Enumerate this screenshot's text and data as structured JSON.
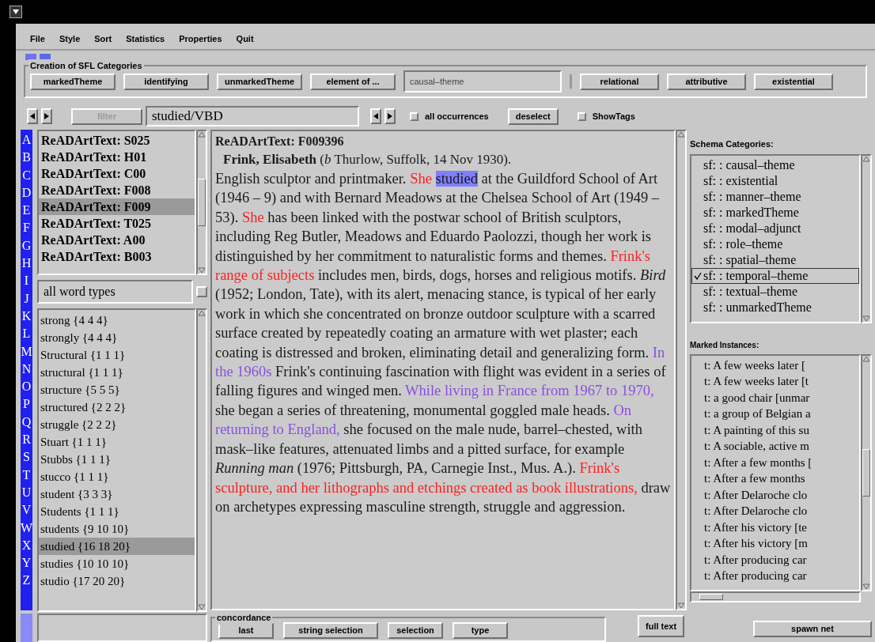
{
  "menu": [
    "File",
    "Style",
    "Sort",
    "Statistics",
    "Properties",
    "Quit"
  ],
  "sfl_group": {
    "title": "Creation of SFL Categories",
    "buttons": [
      "markedTheme",
      "identifying",
      "unmarkedTheme",
      "element of ..."
    ],
    "field_value": "causal–theme",
    "buttons_right": [
      "relational",
      "attributive",
      "existential"
    ]
  },
  "toolbar": {
    "filter": {
      "label": "filter",
      "disabled": true
    },
    "query": "studied/VBD",
    "all_occurrences": {
      "label": "all occurrences",
      "checked": false
    },
    "deselect": "deselect",
    "show_tags": {
      "label": "ShowTags",
      "checked": false
    }
  },
  "alphabet": [
    "A",
    "B",
    "C",
    "D",
    "E",
    "F",
    "G",
    "H",
    "I",
    "J",
    "K",
    "L",
    "M",
    "N",
    "O",
    "P",
    "Q",
    "R",
    "S",
    "T",
    "U",
    "V",
    "W",
    "X",
    "Y",
    "Z"
  ],
  "texts": [
    {
      "label": "ReADArtText: S025",
      "selected": false
    },
    {
      "label": "ReADArtText: H01",
      "selected": false
    },
    {
      "label": "ReADArtText: C00",
      "selected": false
    },
    {
      "label": "ReADArtText: F008",
      "selected": false
    },
    {
      "label": "ReADArtText: F009",
      "selected": true
    },
    {
      "label": "ReADArtText: T025",
      "selected": false
    },
    {
      "label": "ReADArtText: A00",
      "selected": false
    },
    {
      "label": "ReADArtText: B003",
      "selected": false
    }
  ],
  "word_type_filter": "all word types",
  "words": [
    {
      "label": "strong {4 4 4}",
      "selected": false
    },
    {
      "label": "strongly {4 4 4}",
      "selected": false
    },
    {
      "label": "Structural {1 1 1}",
      "selected": false
    },
    {
      "label": "structural {1 1 1}",
      "selected": false
    },
    {
      "label": "structure {5 5 5}",
      "selected": false
    },
    {
      "label": "structured {2 2 2}",
      "selected": false
    },
    {
      "label": "struggle {2 2 2}",
      "selected": false
    },
    {
      "label": "Stuart {1 1 1}",
      "selected": false
    },
    {
      "label": "Stubbs {1 1 1}",
      "selected": false
    },
    {
      "label": "stucco {1 1 1}",
      "selected": false
    },
    {
      "label": "student {3 3 3}",
      "selected": false
    },
    {
      "label": "Students {1 1 1}",
      "selected": false
    },
    {
      "label": "students {9 10 10}",
      "selected": false
    },
    {
      "label": "studied {16 18 20}",
      "selected": true
    },
    {
      "label": "studies {10 10 10}",
      "selected": false
    },
    {
      "label": "studio {17 20 20}",
      "selected": false
    }
  ],
  "document": {
    "title": "ReADArtText: F009396",
    "headword": "Frink, Elisabeth",
    "headword_rest": "(*b* Thurlow, Suffolk, 14 Nov 1930).",
    "segments": [
      {
        "kind": "plain",
        "text": "English sculptor and printmaker. "
      },
      {
        "kind": "marked",
        "text": "She "
      },
      {
        "kind": "selected",
        "text": "studied"
      },
      {
        "kind": "plain",
        "text": " at the Guildford School of Art (1946 – 9) and with Bernard Meadows at the Chelsea School of Art (1949 – 53). "
      },
      {
        "kind": "marked",
        "text": "She"
      },
      {
        "kind": "plain",
        "text": " has been linked with the postwar school of British sculptors, including Reg Butler, Meadows and Eduardo Paolozzi, though her work is distinguished by her commitment to naturalistic forms and themes. "
      },
      {
        "kind": "marked",
        "text": "Frink's range of subjects"
      },
      {
        "kind": "plain",
        "text": " includes men, birds, dogs, horses and religious motifs. "
      },
      {
        "kind": "italic",
        "text": "Bird"
      },
      {
        "kind": "plain",
        "text": " (1952; London, Tate), with its alert, menacing stance, is typical of her early work in which she concentrated on bronze outdoor sculpture with a scarred surface created by repeatedly coating an armature with wet plaster; each coating is distressed and broken, eliminating detail and generalizing form. "
      },
      {
        "kind": "temporal",
        "text": "In the 1960s"
      },
      {
        "kind": "plain",
        "text": " Frink's continuing fascination with flight was evident in a series of falling figures and winged men. "
      },
      {
        "kind": "temporal",
        "text": "While living in France from 1967 to 1970,"
      },
      {
        "kind": "plain",
        "text": " she began a series of threatening, monumental goggled male heads. "
      },
      {
        "kind": "temporal",
        "text": "On returning to England,"
      },
      {
        "kind": "plain",
        "text": " she focused on the male nude, barrel–chested, with mask–like features, attenuated limbs and a pitted surface, for example "
      },
      {
        "kind": "italic",
        "text": "Running man"
      },
      {
        "kind": "plain",
        "text": " (1976; Pittsburgh, PA, Carnegie Inst., Mus. A.). "
      },
      {
        "kind": "marked",
        "text": "Frink's sculpture, and her lithographs and etchings created as book illustrations,"
      },
      {
        "kind": "plain",
        "text": " draw on archetypes expressing masculine strength, struggle and aggression."
      }
    ]
  },
  "schema": {
    "title": "Schema Categories:",
    "items": [
      {
        "label": "sf: : causal–theme",
        "checked": false
      },
      {
        "label": "sf: : existential",
        "checked": false
      },
      {
        "label": "sf: : manner–theme",
        "checked": false
      },
      {
        "label": "sf: : markedTheme",
        "checked": false
      },
      {
        "label": "sf: : modal–adjunct",
        "checked": false
      },
      {
        "label": "sf: : role–theme",
        "checked": false
      },
      {
        "label": "sf: : spatial–theme",
        "checked": false
      },
      {
        "label": "sf: : temporal–theme",
        "checked": true
      },
      {
        "label": "sf: : textual–theme",
        "checked": false
      },
      {
        "label": "sf: : unmarkedTheme",
        "checked": false
      }
    ]
  },
  "instances": {
    "title": "Marked Instances:",
    "items": [
      "t: A few weeks later [",
      "t: A few weeks later [t",
      "t: a good chair [unmar",
      "t: a group of Belgian a",
      "t: A painting of this su",
      "t: A sociable, active m",
      "t: After a few months [",
      "t: After a few months",
      "t: After Delaroche clo",
      "t: After Delaroche clo",
      "t: After his victory [te",
      "t: After his victory [m",
      "t: After producing car",
      "t: After producing car"
    ]
  },
  "concordance": {
    "title": "concordance",
    "buttons": [
      "last",
      "string selection",
      "selection",
      "type"
    ]
  },
  "full_text": "full text",
  "spawn_net": "spawn net"
}
